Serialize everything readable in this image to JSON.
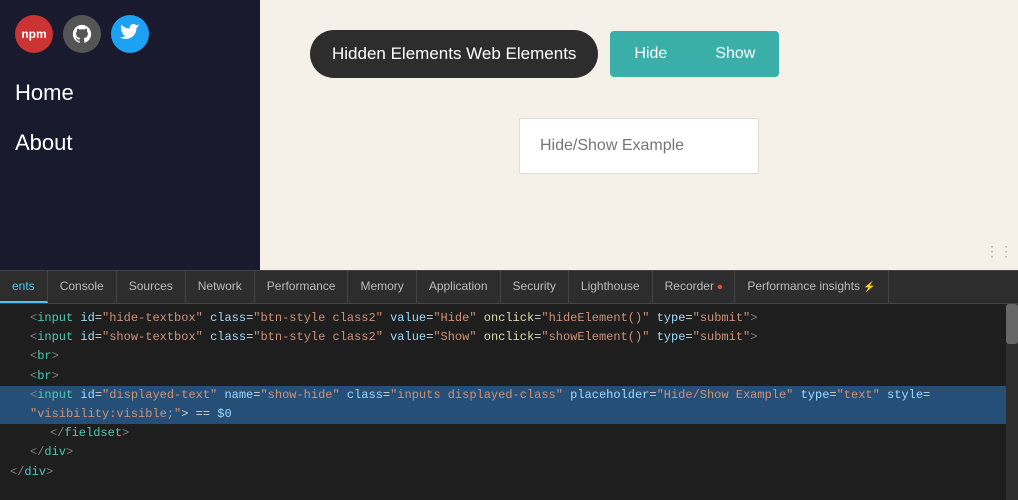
{
  "sidebar": {
    "icons": [
      {
        "label": "npm",
        "symbol": "n",
        "bg": "#cc3333"
      },
      {
        "label": "github",
        "symbol": "⌥",
        "bg": "#555"
      },
      {
        "label": "twitter",
        "symbol": "t",
        "bg": "#1da1f2"
      }
    ],
    "nav_items": [
      {
        "label": "Home"
      },
      {
        "label": "About"
      }
    ]
  },
  "demo": {
    "label": "Hidden Elements Web Elements",
    "hide_btn": "Hide",
    "show_btn": "Show",
    "input_placeholder": "Hide/Show Example"
  },
  "devtools": {
    "tabs": [
      {
        "label": "ents",
        "active": true
      },
      {
        "label": "Console"
      },
      {
        "label": "Sources"
      },
      {
        "label": "Network"
      },
      {
        "label": "Performance"
      },
      {
        "label": "Memory"
      },
      {
        "label": "Application"
      },
      {
        "label": "Security"
      },
      {
        "label": "Lighthouse"
      },
      {
        "label": "Recorder"
      },
      {
        "label": "Performance insights"
      }
    ],
    "code_lines": [
      {
        "indent": 1,
        "content": "<input id=\"hide-textbox\" class=\"btn-style class2\" value=\"Hide\" onclick=\"hideElement()\" type=\"submit\">",
        "highlighted": false
      },
      {
        "indent": 1,
        "content": "<input id=\"show-textbox\" class=\"btn-style class2\" value=\"Show\" onclick=\"showElement()\" type=\"submit\">",
        "highlighted": false
      },
      {
        "indent": 1,
        "content": "<br>",
        "highlighted": false
      },
      {
        "indent": 1,
        "content": "<br>",
        "highlighted": false
      },
      {
        "indent": 1,
        "content": "<input id=\"displayed-text\" name=\"show-hide\" class=\"inputs displayed-class\" placeholder=\"Hide/Show Example\" type=\"text\" style=",
        "highlighted": true
      },
      {
        "indent": 1,
        "content": "\"visibility:visible;\"> == $0",
        "highlighted": true
      },
      {
        "indent": 2,
        "content": "</fieldset>",
        "highlighted": false
      },
      {
        "indent": 1,
        "content": "</div>",
        "highlighted": false
      },
      {
        "indent": 0,
        "content": "</div>",
        "highlighted": false
      }
    ]
  }
}
